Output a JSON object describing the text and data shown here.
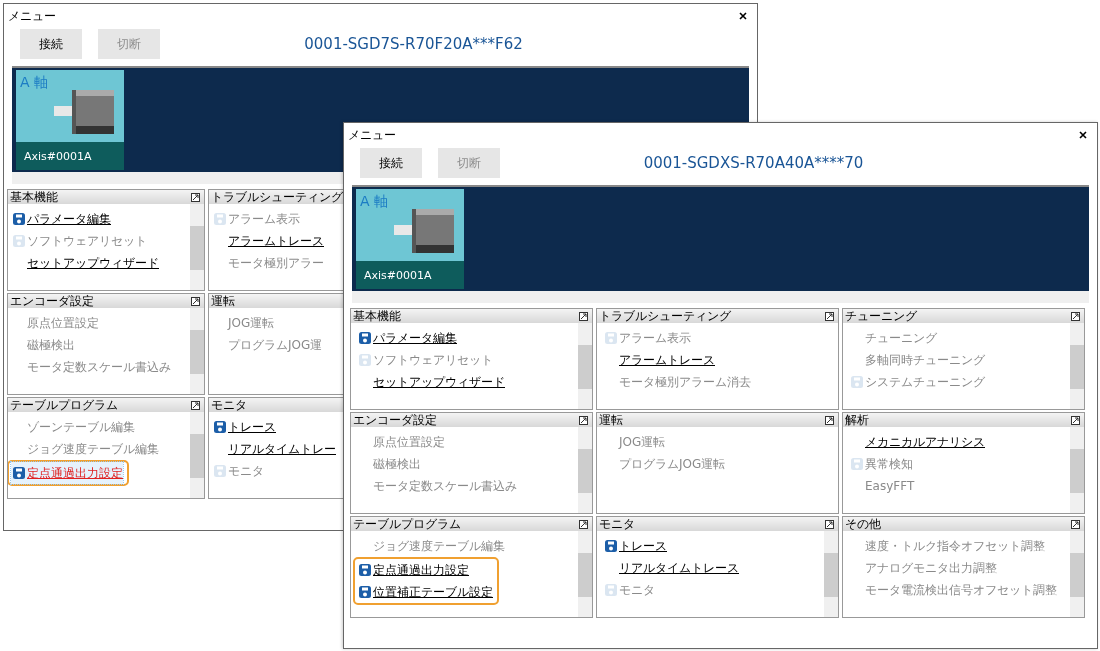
{
  "windows": [
    {
      "kind": "back",
      "title": "メニュー",
      "buttons": [
        {
          "label": "接続",
          "disabled": false
        },
        {
          "label": "切断",
          "disabled": true
        }
      ],
      "model": "0001-SGD7S-R70F20A***F62",
      "axis": {
        "label": "A 軸",
        "name": "Axis#0001A"
      },
      "columns": [
        [
          {
            "title": "基本機能",
            "scrollable": true,
            "items": [
              {
                "label": "パラメータ編集",
                "icon": true,
                "enabled": true,
                "selected": false,
                "highlighted": false
              },
              {
                "label": "ソフトウェアリセット",
                "icon": true,
                "enabled": false,
                "selected": false,
                "highlighted": false
              },
              {
                "label": "セットアップウィザード",
                "icon": false,
                "enabled": true,
                "selected": false,
                "highlighted": false
              }
            ]
          },
          {
            "title": "エンコーダ設定",
            "scrollable": true,
            "items": [
              {
                "label": "原点位置設定",
                "icon": false,
                "enabled": false,
                "selected": false,
                "highlighted": false
              },
              {
                "label": "磁極検出",
                "icon": false,
                "enabled": false,
                "selected": false,
                "highlighted": false
              },
              {
                "label": "モータ定数スケール書込み",
                "icon": false,
                "enabled": false,
                "selected": false,
                "highlighted": false
              }
            ]
          },
          {
            "title": "テーブルプログラム",
            "scrollable": true,
            "items": [
              {
                "label": "ゾーンテーブル編集",
                "icon": false,
                "enabled": false,
                "selected": false,
                "highlighted": false
              },
              {
                "label": "ジョグ速度テーブル編集",
                "icon": false,
                "enabled": false,
                "selected": false,
                "highlighted": false
              },
              {
                "label": "定点通過出力設定",
                "icon": true,
                "enabled": true,
                "selected": true,
                "highlighted": true
              }
            ]
          }
        ],
        [
          {
            "title": "トラブルシューティング",
            "items": [
              {
                "label": "アラーム表示",
                "icon": true,
                "enabled": false,
                "selected": false,
                "highlighted": false
              },
              {
                "label": "アラームトレース",
                "icon": false,
                "enabled": true,
                "selected": false,
                "highlighted": false
              },
              {
                "label": "モータ極別アラー",
                "icon": false,
                "enabled": false,
                "selected": false,
                "highlighted": false
              }
            ]
          },
          {
            "title": "運転",
            "items": [
              {
                "label": "JOG運転",
                "icon": false,
                "enabled": false,
                "selected": false,
                "highlighted": false
              },
              {
                "label": "プログラムJOG運",
                "icon": false,
                "enabled": false,
                "selected": false,
                "highlighted": false
              }
            ]
          },
          {
            "title": "モニタ",
            "items": [
              {
                "label": "トレース",
                "icon": true,
                "enabled": true,
                "selected": false,
                "highlighted": false
              },
              {
                "label": "リアルタイムトレー",
                "icon": false,
                "enabled": true,
                "selected": false,
                "highlighted": false
              },
              {
                "label": "モニタ",
                "icon": true,
                "enabled": false,
                "selected": false,
                "highlighted": false
              }
            ]
          }
        ]
      ]
    },
    {
      "kind": "front",
      "title": "メニュー",
      "buttons": [
        {
          "label": "接続",
          "disabled": false
        },
        {
          "label": "切断",
          "disabled": true
        }
      ],
      "model": "0001-SGDXS-R70A40A****70",
      "axis": {
        "label": "A 軸",
        "name": "Axis#0001A"
      },
      "columns": [
        [
          {
            "title": "基本機能",
            "scrollable": true,
            "items": [
              {
                "label": "パラメータ編集",
                "icon": true,
                "enabled": true,
                "selected": false,
                "highlighted": false
              },
              {
                "label": "ソフトウェアリセット",
                "icon": true,
                "enabled": false,
                "selected": false,
                "highlighted": false
              },
              {
                "label": "セットアップウィザード",
                "icon": false,
                "enabled": true,
                "selected": false,
                "highlighted": false
              }
            ]
          },
          {
            "title": "エンコーダ設定",
            "scrollable": true,
            "items": [
              {
                "label": "原点位置設定",
                "icon": false,
                "enabled": false,
                "selected": false,
                "highlighted": false
              },
              {
                "label": "磁極検出",
                "icon": false,
                "enabled": false,
                "selected": false,
                "highlighted": false
              },
              {
                "label": "モータ定数スケール書込み",
                "icon": false,
                "enabled": false,
                "selected": false,
                "highlighted": false
              }
            ]
          },
          {
            "title": "テーブルプログラム",
            "scrollable": true,
            "items": [
              {
                "label": "ジョグ速度テーブル編集",
                "icon": false,
                "enabled": false,
                "selected": false,
                "highlighted": false
              },
              {
                "label": "定点通過出力設定",
                "icon": true,
                "enabled": true,
                "selected": false,
                "highlighted": true
              },
              {
                "label": "位置補正テーブル設定",
                "icon": true,
                "enabled": true,
                "selected": false,
                "highlighted": true
              }
            ]
          }
        ],
        [
          {
            "title": "トラブルシューティング",
            "scrollable": false,
            "items": [
              {
                "label": "アラーム表示",
                "icon": true,
                "enabled": false,
                "selected": false,
                "highlighted": false
              },
              {
                "label": "アラームトレース",
                "icon": false,
                "enabled": true,
                "selected": false,
                "highlighted": false
              },
              {
                "label": "モータ極別アラーム消去",
                "icon": false,
                "enabled": false,
                "selected": false,
                "highlighted": false
              }
            ]
          },
          {
            "title": "運転",
            "scrollable": false,
            "items": [
              {
                "label": "JOG運転",
                "icon": false,
                "enabled": false,
                "selected": false,
                "highlighted": false
              },
              {
                "label": "プログラムJOG運転",
                "icon": false,
                "enabled": false,
                "selected": false,
                "highlighted": false
              }
            ]
          },
          {
            "title": "モニタ",
            "scrollable": true,
            "items": [
              {
                "label": "トレース",
                "icon": true,
                "enabled": true,
                "selected": false,
                "highlighted": false
              },
              {
                "label": "リアルタイムトレース",
                "icon": false,
                "enabled": true,
                "selected": false,
                "highlighted": false
              },
              {
                "label": "モニタ",
                "icon": true,
                "enabled": false,
                "selected": false,
                "highlighted": false
              }
            ]
          }
        ],
        [
          {
            "title": "チューニング",
            "scrollable": true,
            "items": [
              {
                "label": "チューニング",
                "icon": false,
                "enabled": false,
                "selected": false,
                "highlighted": false
              },
              {
                "label": "多軸同時チューニング",
                "icon": false,
                "enabled": false,
                "selected": false,
                "highlighted": false
              },
              {
                "label": "システムチューニング",
                "icon": true,
                "enabled": false,
                "selected": false,
                "highlighted": false
              }
            ]
          },
          {
            "title": "解析",
            "scrollable": true,
            "items": [
              {
                "label": "メカニカルアナリシス",
                "icon": false,
                "enabled": true,
                "selected": false,
                "highlighted": false
              },
              {
                "label": "異常検知",
                "icon": true,
                "enabled": false,
                "selected": false,
                "highlighted": false
              },
              {
                "label": "EasyFFT",
                "icon": false,
                "enabled": false,
                "selected": false,
                "highlighted": false
              }
            ]
          },
          {
            "title": "その他",
            "scrollable": true,
            "items": [
              {
                "label": "速度・トルク指令オフセット調整",
                "icon": false,
                "enabled": false,
                "selected": false,
                "highlighted": false
              },
              {
                "label": "アナログモニタ出力調整",
                "icon": false,
                "enabled": false,
                "selected": false,
                "highlighted": false
              },
              {
                "label": "モータ電流検出信号オフセット調整",
                "icon": false,
                "enabled": false,
                "selected": false,
                "highlighted": false
              }
            ]
          }
        ]
      ]
    }
  ]
}
